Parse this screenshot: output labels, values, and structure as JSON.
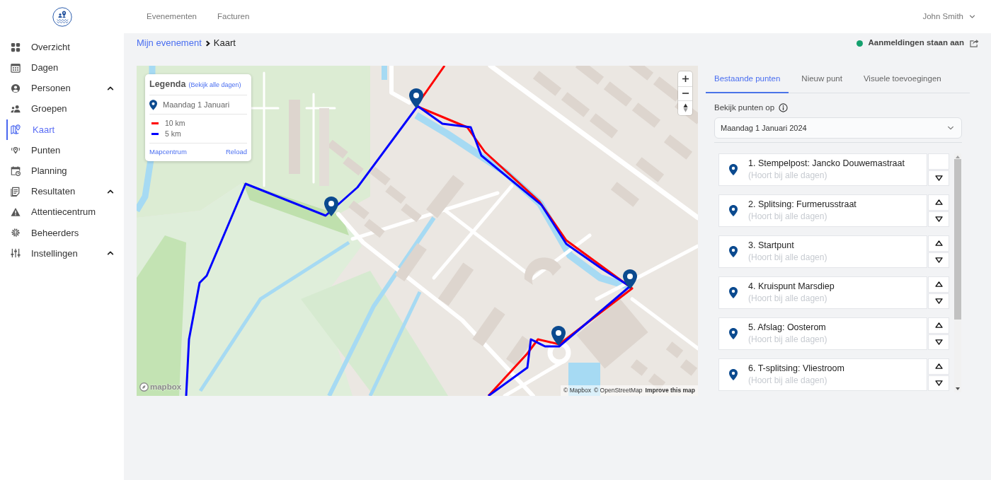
{
  "header": {
    "nav": [
      {
        "label": "Evenementen"
      },
      {
        "label": "Facturen"
      }
    ],
    "user": "John Smith"
  },
  "sidebar": {
    "items": [
      {
        "label": "Overzicht",
        "selected": false
      },
      {
        "label": "Dagen",
        "selected": false
      },
      {
        "label": "Personen",
        "selected": false,
        "expanded": true
      },
      {
        "label": "Groepen",
        "selected": false
      },
      {
        "label": "Kaart",
        "selected": true
      },
      {
        "label": "Punten",
        "selected": false
      },
      {
        "label": "Planning",
        "selected": false
      },
      {
        "label": "Resultaten",
        "selected": false,
        "expanded": true
      },
      {
        "label": "Attentiecentrum",
        "selected": false
      },
      {
        "label": "Beheerders",
        "selected": false
      },
      {
        "label": "Instellingen",
        "selected": false,
        "expanded": true
      }
    ]
  },
  "breadcrumb": {
    "items": [
      "Mijn evenement",
      "Kaart"
    ]
  },
  "status": {
    "label": "Aanmeldingen staan aan",
    "on": true
  },
  "map": {
    "legend": {
      "title": "Legenda",
      "all_days_link": "(Bekijk alle dagen)",
      "day": "Maandag 1 Januari",
      "routes": [
        {
          "label": "10 km",
          "color": "#ff0000"
        },
        {
          "label": "5 km",
          "color": "#0000ff"
        }
      ],
      "center_link": "Mapcentrum",
      "reload_link": "Reload"
    },
    "logo": "mapbox",
    "attribution": [
      "© Mapbox",
      "© OpenStreetMap"
    ],
    "improve_link": "Improve this map"
  },
  "panel": {
    "tabs": [
      {
        "label": "Bestaande punten",
        "selected": true
      },
      {
        "label": "Nieuw punt",
        "selected": false
      },
      {
        "label": "Visuele toevoegingen",
        "selected": false
      }
    ],
    "filter": {
      "label": "Bekijk punten op",
      "value": "Maandag 1 Januari 2024"
    },
    "points": [
      {
        "title": "1. Stempelpost: Jancko Douwemastraat",
        "note": "(Hoort bij alle dagen)",
        "can_move_up": false,
        "can_move_down": true
      },
      {
        "title": "2. Splitsing: Furmerusstraat",
        "note": "(Hoort bij alle dagen)",
        "can_move_up": true,
        "can_move_down": true
      },
      {
        "title": "3. Startpunt",
        "note": "(Hoort bij alle dagen)",
        "can_move_up": true,
        "can_move_down": true
      },
      {
        "title": "4. Kruispunt Marsdiep",
        "note": "(Hoort bij alle dagen)",
        "can_move_up": true,
        "can_move_down": true
      },
      {
        "title": "5. Afslag: Oosterom",
        "note": "(Hoort bij alle dagen)",
        "can_move_up": true,
        "can_move_down": true
      },
      {
        "title": "6. T-splitsing: Vliestroom",
        "note": "(Hoort bij alle dagen)",
        "can_move_up": true,
        "can_move_down": true
      }
    ]
  }
}
